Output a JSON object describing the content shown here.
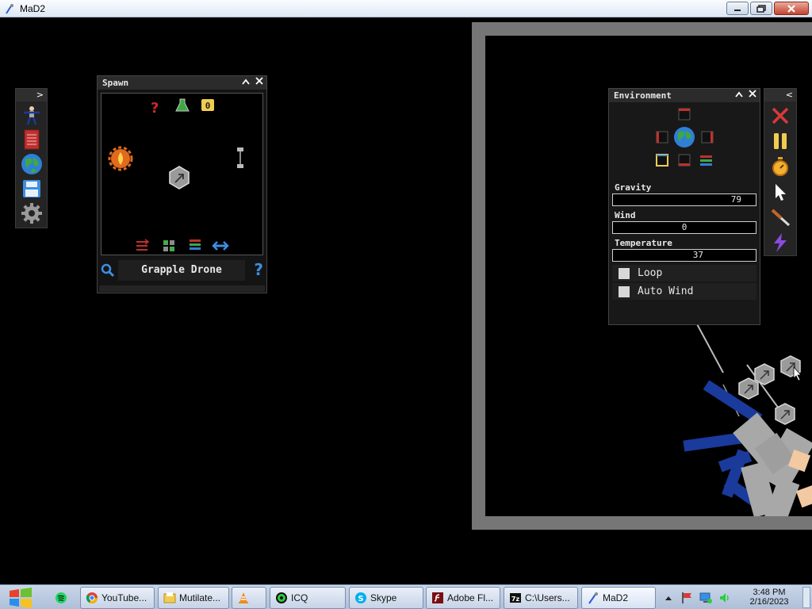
{
  "window": {
    "title": "MaD2"
  },
  "colors": {
    "panel_bg": "#141414",
    "frame_gray": "#767676",
    "ragdoll_blue": "#1a3a9c",
    "ragdoll_gray": "#a8a8a8",
    "skin": "#f2c9a0"
  },
  "left_toolbar": {
    "items": [
      {
        "icon": "ragdoll-icon"
      },
      {
        "icon": "book-icon"
      },
      {
        "icon": "globe-icon"
      },
      {
        "icon": "save-icon"
      },
      {
        "icon": "gear-icon"
      }
    ]
  },
  "spawn": {
    "title": "Spawn",
    "counter": "0",
    "selected_name": "Grapple Drone",
    "help": "?"
  },
  "environment": {
    "title": "Environment",
    "gravity_label": "Gravity",
    "gravity_value": "79",
    "wind_label": "Wind",
    "wind_value": "0",
    "temperature_label": "Temperature",
    "temperature_value": "37",
    "loop_label": "Loop",
    "auto_wind_label": "Auto Wind"
  },
  "right_toolbar": {
    "items": [
      {
        "icon": "close-x-icon"
      },
      {
        "icon": "pause-icon"
      },
      {
        "icon": "stopwatch-icon"
      },
      {
        "icon": "cursor-icon"
      },
      {
        "icon": "knife-icon"
      },
      {
        "icon": "lightning-icon"
      }
    ]
  },
  "taskbar": {
    "tasks": [
      {
        "label": "YouTube..."
      },
      {
        "label": "Mutilate..."
      },
      {
        "label": ""
      },
      {
        "label": "ICQ"
      },
      {
        "label": "Skype"
      },
      {
        "label": "Adobe Fl..."
      },
      {
        "label": "C:\\Users..."
      },
      {
        "label": "MaD2"
      }
    ],
    "time": "3:48 PM",
    "date": "2/16/2023"
  }
}
